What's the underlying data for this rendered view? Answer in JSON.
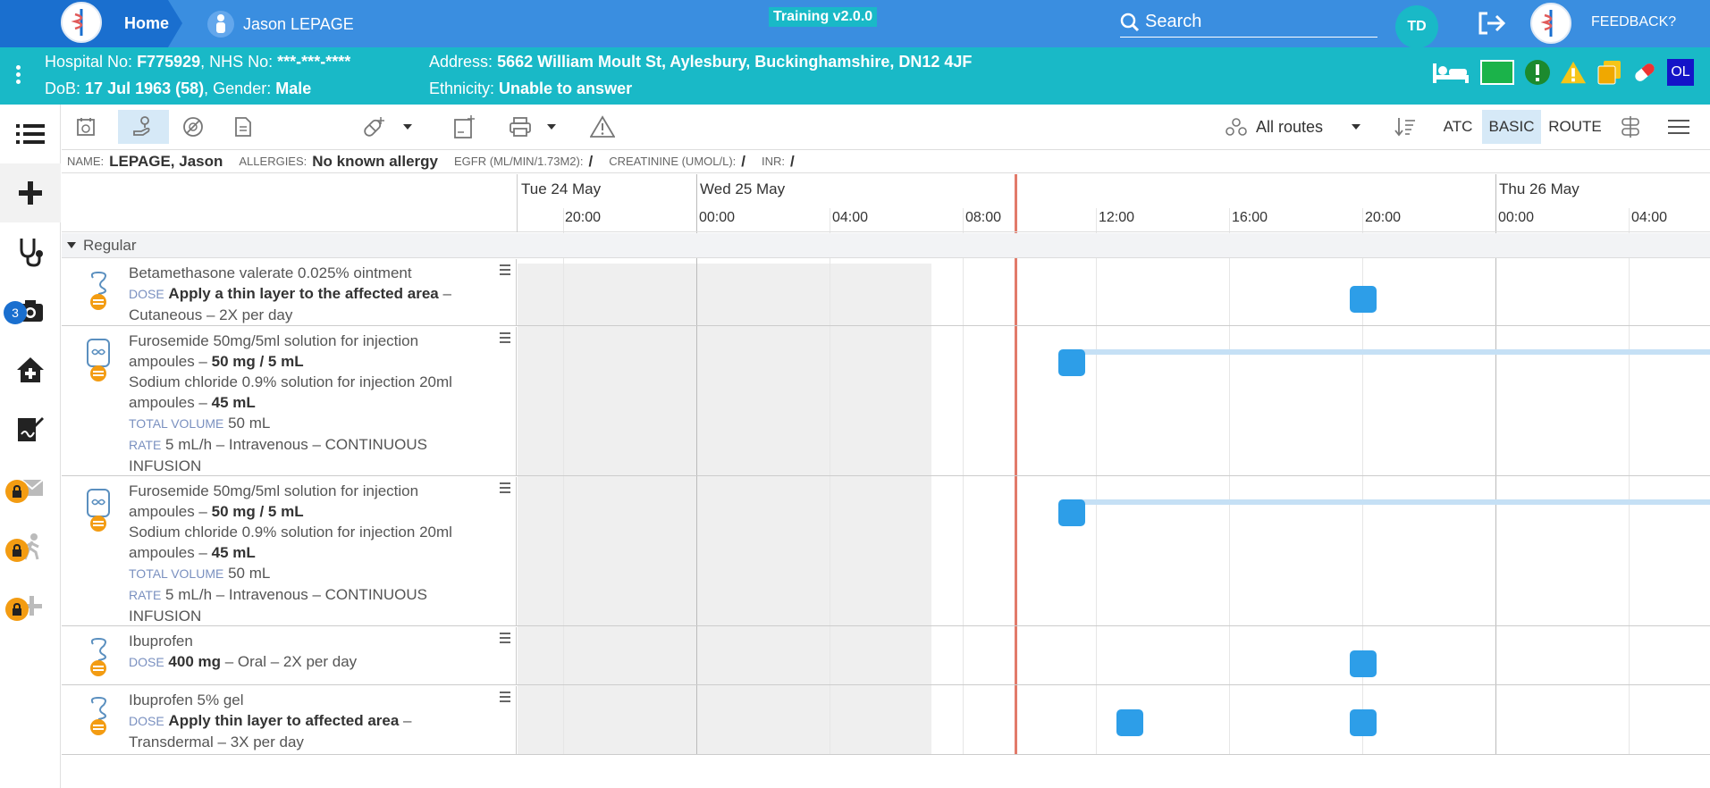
{
  "topbar": {
    "home_label": "Home",
    "patient_name": "Jason LEPAGE",
    "training_label": "Training v2.0.0",
    "search_placeholder": "Search",
    "user_initials": "TD",
    "feedback_label": "FEEDBACK?",
    "colors": {
      "bar": "#3a8ee0",
      "home": "#1a6fcf",
      "accent": "#19b9c7"
    }
  },
  "banner": {
    "hospital_no_label": "Hospital No:",
    "hospital_no": "F775929",
    "nhs_no_label": "NHS No:",
    "nhs_no": "***-***-****",
    "dob_label": "DoB:",
    "dob": "17 Jul 1963 (58)",
    "gender_label": "Gender:",
    "gender": "Male",
    "address_label": "Address:",
    "address": "5662 William Moult St, Aylesbury, Buckinghamshire, DN12 4JF",
    "ethnicity_label": "Ethnicity:",
    "ethnicity": "Unable to answer",
    "ol_badge": "OL",
    "icons": [
      "bed-icon",
      "green-square-icon",
      "alert-circle-icon",
      "warning-icon",
      "documents-icon",
      "pill-icon",
      "ol-badge"
    ]
  },
  "rail": {
    "icons": [
      "list-icon",
      "plus-icon",
      "stethoscope-icon",
      "camera-icon",
      "home-medical-icon",
      "signature-icon",
      "mail-lock-icon",
      "walking-lock-icon",
      "add-lock-icon"
    ],
    "camera_badge": "3"
  },
  "toolbar": {
    "routes_label": "All routes",
    "atc_label": "ATC",
    "basic_label": "BASIC",
    "route_label": "ROUTE"
  },
  "inforow": {
    "name_label": "NAME:",
    "name": "LEPAGE, Jason",
    "allergies_label": "ALLERGIES:",
    "allergies": "No known allergy",
    "egfr_label": "EGFR (ML/MIN/1.73M2):",
    "egfr": "/",
    "creatinine_label": "CREATININE (UMOL/L):",
    "creatinine": "/",
    "inr_label": "INR:",
    "inr": "/"
  },
  "timeline": {
    "days": [
      "Tue 24 May",
      "Wed 25 May",
      "Thu 26 May"
    ],
    "hours": [
      "20:00",
      "00:00",
      "04:00",
      "08:00",
      "12:00",
      "16:00",
      "20:00",
      "00:00",
      "04:00"
    ]
  },
  "group": {
    "label": "Regular"
  },
  "medications": [
    {
      "name": "Betamethasone valerate 0.025% ointment",
      "dose_label": "DOSE",
      "dose": "Apply a thin layer to the affected area",
      "detail": " – Cutaneous – 2X per day"
    },
    {
      "line1": "Furosemide 50mg/5ml solution for injection ampoules – ",
      "line1_bold": "50 mg / 5 mL",
      "line2": "Sodium chloride 0.9% solution for injection 20ml ampoules – ",
      "line2_bold": "45 mL",
      "total_label": "TOTAL VOLUME",
      "total": "50 mL",
      "rate_label": "RATE",
      "rate": "5 mL/h – Intravenous – CONTINUOUS INFUSION"
    },
    {
      "line1": "Furosemide 50mg/5ml solution for injection ampoules – ",
      "line1_bold": "50 mg / 5 mL",
      "line2": "Sodium chloride 0.9% solution for injection 20ml ampoules – ",
      "line2_bold": "45 mL",
      "total_label": "TOTAL VOLUME",
      "total": "50 mL",
      "rate_label": "RATE",
      "rate": "5 mL/h – Intravenous – CONTINUOUS INFUSION"
    },
    {
      "name": "Ibuprofen",
      "dose_label": "DOSE",
      "dose": "400 mg",
      "detail": " – Oral – 2X per day"
    },
    {
      "name": "Ibuprofen 5% gel",
      "dose_label": "DOSE",
      "dose": "Apply thin layer to affected area",
      "detail": " – Transdermal – 3X per day"
    }
  ]
}
